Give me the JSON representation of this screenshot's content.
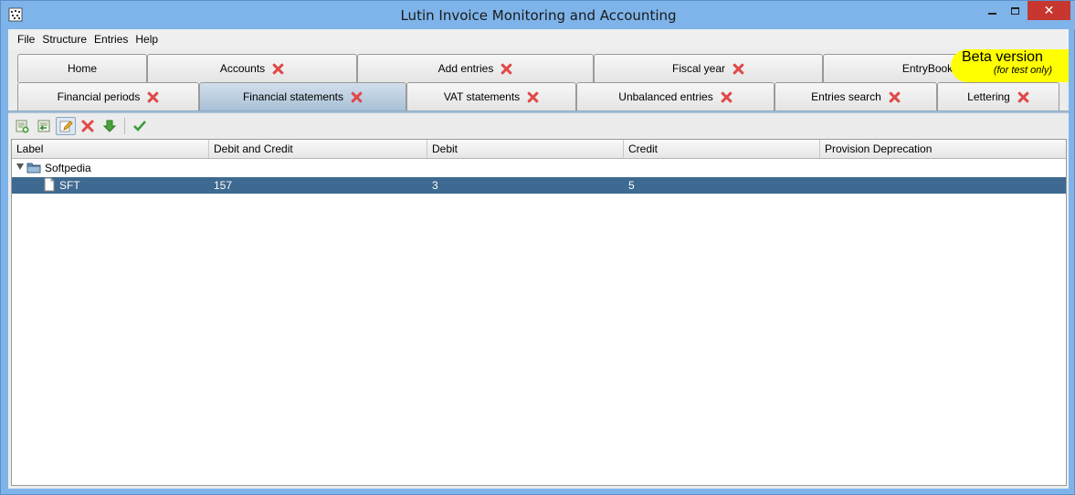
{
  "window": {
    "title": "Lutin Invoice Monitoring and Accounting",
    "close_label": "✕"
  },
  "menu": [
    "File",
    "Structure",
    "Entries",
    "Help"
  ],
  "tabs_row1": [
    {
      "label": "Home",
      "closable": false
    },
    {
      "label": "Accounts",
      "closable": true
    },
    {
      "label": "Add entries",
      "closable": true
    },
    {
      "label": "Fiscal year",
      "closable": true
    },
    {
      "label": "EntryBooks",
      "closable": false
    }
  ],
  "tabs_row2": [
    {
      "label": "Financial periods",
      "closable": true
    },
    {
      "label": "Financial statements",
      "closable": true,
      "active": true
    },
    {
      "label": "VAT statements",
      "closable": true
    },
    {
      "label": "Unbalanced entries",
      "closable": true
    },
    {
      "label": "Entries search",
      "closable": true
    },
    {
      "label": "Lettering",
      "closable": true
    }
  ],
  "beta": {
    "title": "Beta version",
    "subtitle": "(for test only)"
  },
  "toolbar": [
    "add-icon",
    "import-icon",
    "edit-icon",
    "delete-icon",
    "download-icon",
    "validate-icon"
  ],
  "table": {
    "columns": [
      "Label",
      "Debit and Credit",
      "Debit",
      "Credit",
      "Provision Deprecation"
    ],
    "rows": [
      {
        "type": "folder",
        "label": "Softpedia",
        "debit_credit": "",
        "debit": "",
        "credit": "",
        "provision": ""
      },
      {
        "type": "file",
        "label": "SFT",
        "debit_credit": "157",
        "debit": "3",
        "credit": "5",
        "provision": "",
        "selected": true
      }
    ]
  },
  "colors": {
    "selection": "#3e6990",
    "beta_bg": "#ffff00",
    "close_icon": "#e04848",
    "titlebar": "#7eb4ea"
  }
}
